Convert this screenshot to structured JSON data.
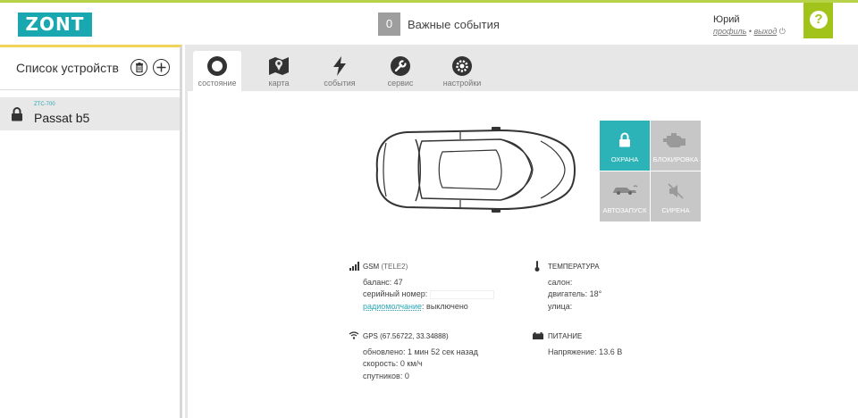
{
  "header": {
    "logo": "ZONT",
    "events_count": "0",
    "events_label": "Важные события",
    "user_name": "Юрий",
    "profile_link": "профиль",
    "separator": "•",
    "logout_link": "выход",
    "help": "?"
  },
  "sidebar": {
    "title": "Список устройств",
    "device": {
      "model": "ZTC-700",
      "name": "Passat b5"
    }
  },
  "tabs": [
    {
      "label": "состояние",
      "icon": "circle-record-icon"
    },
    {
      "label": "карта",
      "icon": "map-icon"
    },
    {
      "label": "события",
      "icon": "lightning-icon"
    },
    {
      "label": "сервис",
      "icon": "wrench-icon"
    },
    {
      "label": "настройки",
      "icon": "gear-icon"
    }
  ],
  "controls": {
    "guard": "ОХРАНА",
    "block": "БЛОКИРОВКА",
    "autostart": "АВТОЗАПУСК",
    "siren": "СИРЕНА"
  },
  "gsm": {
    "title": "GSM",
    "operator": "(TELE2)",
    "balance": "баланс: 47",
    "serial_label": "серийный номер:",
    "silent_link": "радиомолчание",
    "silent_value": ": выключено"
  },
  "gps": {
    "title": "GPS",
    "coords": "(67.56722, 33.34888)",
    "updated": "обновлено: 1 мин 52 сек назад",
    "speed": "скорость: 0 км/ч",
    "satellites": "спутников: 0"
  },
  "temperature": {
    "title": "ТЕМПЕРАТУРА",
    "cabin": "салон:",
    "engine": "двигатель: 18°",
    "street": "улица:"
  },
  "power": {
    "title": "ПИТАНИЕ",
    "voltage": "Напряжение: 13.6 В"
  },
  "colors": {
    "accent": "#2bb3b7",
    "help_bg": "#a2c41a",
    "top_border": "#b7d34a"
  }
}
